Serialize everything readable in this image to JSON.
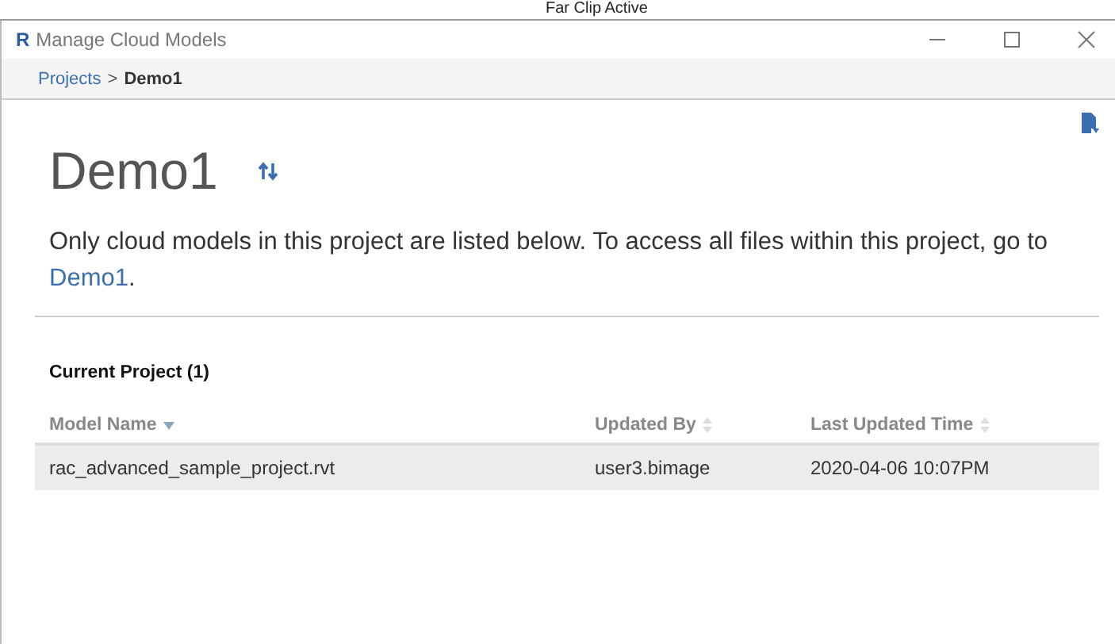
{
  "background_window": {
    "label": "Far Clip Active"
  },
  "window": {
    "logo": "R",
    "title": "Manage Cloud Models"
  },
  "breadcrumb_separator": ">",
  "breadcrumb": [
    {
      "label": "Projects",
      "kind": "link"
    },
    {
      "label": "Demo1",
      "kind": "current"
    }
  ],
  "heading": "Demo1",
  "description": {
    "text": "Only cloud models in this project are listed below. To access all files within this project, go to ",
    "link": "Demo1",
    "end": "."
  },
  "section_title": "Current Project (1)",
  "table": {
    "columns": [
      {
        "label": "Model Name",
        "sorted": true
      },
      {
        "label": "Updated By",
        "sorted": false
      },
      {
        "label": "Last Updated Time",
        "sorted": false
      }
    ],
    "rows": [
      {
        "cells": [
          "rac_advanced_sample_project.rvt",
          "user3.bimage",
          "2020-04-06 10:07PM"
        ],
        "selected": true
      }
    ]
  }
}
